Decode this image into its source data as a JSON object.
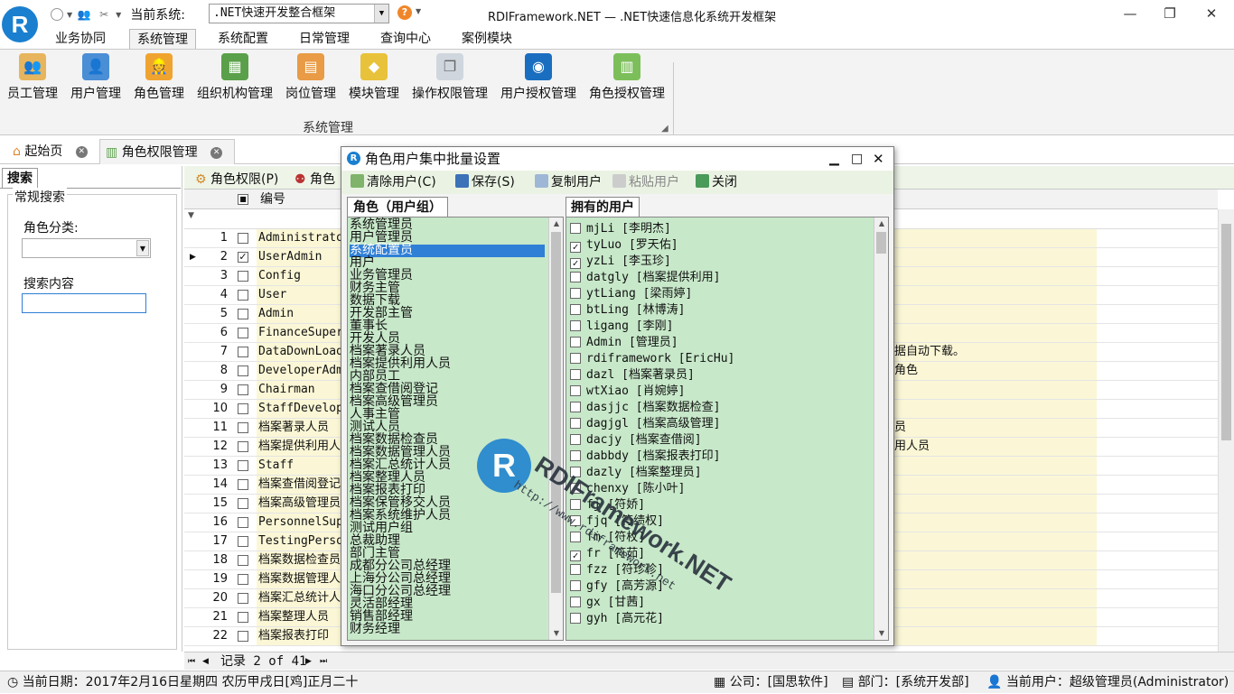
{
  "title_bar": {
    "logo_letter": "R",
    "current_system_label": "当前系统:",
    "current_system_value": ".NET快速开发整合框架",
    "window_title": "RDIFramework.NET — .NET快速信息化系统开发框架",
    "minimize": "—",
    "maximize": "❐",
    "close": "✕"
  },
  "menu_tabs": [
    "业务协同",
    "系统管理",
    "系统配置",
    "日常管理",
    "查询中心",
    "案例模块"
  ],
  "active_menu_tab": "系统管理",
  "ribbon": {
    "buttons": [
      "员工管理",
      "用户管理",
      "角色管理",
      "组织机构管理",
      "岗位管理",
      "模块管理",
      "操作权限管理",
      "用户授权管理",
      "角色授权管理"
    ],
    "group_label": "系统管理"
  },
  "doc_tabs": [
    {
      "label": "起始页"
    },
    {
      "label": "角色权限管理"
    }
  ],
  "left_panel": {
    "tab": "搜索",
    "legend": "常规搜索",
    "category_label": "角色分类:",
    "category_value": "",
    "content_label": "搜索内容",
    "content_value": ""
  },
  "grid": {
    "toolbar": [
      "角色权限(P)",
      "角色"
    ],
    "header_col": "编号",
    "rows": [
      {
        "n": "1",
        "code": "Administrator",
        "checked": false,
        "extra": ""
      },
      {
        "n": "2",
        "code": "UserAdmin",
        "checked": true,
        "extra": ""
      },
      {
        "n": "3",
        "code": "Config",
        "checked": false,
        "extra": ""
      },
      {
        "n": "4",
        "code": "User",
        "checked": false,
        "extra": ""
      },
      {
        "n": "5",
        "code": "Admin",
        "checked": false,
        "extra": ""
      },
      {
        "n": "6",
        "code": "FinanceSuperv",
        "checked": false,
        "extra": ""
      },
      {
        "n": "7",
        "code": "DataDownLoad",
        "checked": false,
        "extra": "据自动下载。"
      },
      {
        "n": "8",
        "code": "DeveloperAdmi",
        "checked": false,
        "extra": "角色"
      },
      {
        "n": "9",
        "code": "Chairman",
        "checked": false,
        "extra": ""
      },
      {
        "n": "10",
        "code": "StaffDevelopm",
        "checked": false,
        "extra": ""
      },
      {
        "n": "11",
        "code": "档案著录人员",
        "checked": false,
        "extra": "员"
      },
      {
        "n": "12",
        "code": "档案提供利用人",
        "checked": false,
        "extra": "用人员"
      },
      {
        "n": "13",
        "code": "Staff",
        "checked": false,
        "extra": ""
      },
      {
        "n": "14",
        "code": "档案查借阅登记",
        "checked": false,
        "extra": ""
      },
      {
        "n": "15",
        "code": "档案高级管理员",
        "checked": false,
        "extra": ""
      },
      {
        "n": "16",
        "code": "PersonnelSupe",
        "checked": false,
        "extra": ""
      },
      {
        "n": "17",
        "code": "TestingPerson",
        "checked": false,
        "extra": ""
      },
      {
        "n": "18",
        "code": "档案数据检查员",
        "checked": false,
        "extra": ""
      },
      {
        "n": "19",
        "code": "档案数据管理人",
        "checked": false,
        "extra": ""
      },
      {
        "n": "20",
        "code": "档案汇总统计人",
        "checked": false,
        "extra": ""
      },
      {
        "n": "21",
        "code": "档案整理人员",
        "checked": false,
        "extra": ""
      },
      {
        "n": "22",
        "code": "档案报表打印",
        "checked": false,
        "extra": ""
      }
    ],
    "pager_text": "记录 2 of 41"
  },
  "dialog": {
    "title": "角色用户集中批量设置",
    "toolbar": [
      "清除用户(C)",
      "保存(S)",
      "复制用户",
      "粘贴用户",
      "关闭"
    ],
    "roles_header": "角色（用户组）",
    "users_header": "拥有的用户",
    "roles": [
      "系统管理员",
      "用户管理员",
      "系统配置员",
      "用户",
      "业务管理员",
      "财务主管",
      "数据下载",
      "开发部主管",
      "董事长",
      "开发人员",
      "档案著录人员",
      "档案提供利用人员",
      "内部员工",
      "档案查借阅登记",
      "档案高级管理员",
      "人事主管",
      "测试人员",
      "档案数据检查员",
      "档案数据管理人员",
      "档案汇总统计人员",
      "档案整理人员",
      "档案报表打印",
      "档案保管移交人员",
      "档案系统维护人员",
      "测试用户组",
      "总裁助理",
      "部门主管",
      "成都分公司总经理",
      "上海分公司总经理",
      "海口分公司总经理",
      "灵活部经理",
      "销售部经理",
      "财务经理"
    ],
    "selected_role": "系统配置员",
    "users": [
      {
        "label": "mjLi [李明杰]",
        "checked": false
      },
      {
        "label": "tyLuo [罗天佑]",
        "checked": true
      },
      {
        "label": "yzLi [李玉珍]",
        "checked": true
      },
      {
        "label": "datgly [档案提供利用]",
        "checked": false
      },
      {
        "label": "ytLiang [梁雨婷]",
        "checked": false
      },
      {
        "label": "btLing [林博涛]",
        "checked": false
      },
      {
        "label": "ligang [李刚]",
        "checked": false
      },
      {
        "label": "Admin [管理员]",
        "checked": false
      },
      {
        "label": "rdiframework [EricHu]",
        "checked": false
      },
      {
        "label": "dazl [档案著录员]",
        "checked": false
      },
      {
        "label": "wtXiao [肖婉婷]",
        "checked": false
      },
      {
        "label": "dasjjc [档案数据检查]",
        "checked": false
      },
      {
        "label": "dagjgl [档案高级管理]",
        "checked": false
      },
      {
        "label": "dacjy [档案查借阅]",
        "checked": false
      },
      {
        "label": "dabbdy [档案报表打印]",
        "checked": false
      },
      {
        "label": "dazly [档案整理员]",
        "checked": false
      },
      {
        "label": "chenxy [陈小叶]",
        "checked": false
      },
      {
        "label": "fj [符娇]",
        "checked": false
      },
      {
        "label": "fjq [符绩权]",
        "checked": false
      },
      {
        "label": "fm [符枚]",
        "checked": false
      },
      {
        "label": "fr [符茹]",
        "checked": true
      },
      {
        "label": "fzz [符珍珍]",
        "checked": false
      },
      {
        "label": "gfy [高芳源]",
        "checked": false
      },
      {
        "label": "gx [甘茜]",
        "checked": false
      },
      {
        "label": "gyh [高元花]",
        "checked": false
      }
    ]
  },
  "watermark": {
    "brand": "RDIFramework.NET",
    "url": "http://www.rdiframework.net"
  },
  "status_bar": {
    "date": "当前日期：2017年2月16日星期四 农历甲戌日[鸡]正月二十",
    "company": "公司：[国思软件]",
    "department": "部门：[系统开发部]",
    "user": "当前用户：超级管理员(Administrator)"
  },
  "colors": {
    "accent": "#1a7fcf",
    "list_bg": "#c7e8c9",
    "selection": "#2f7fd6",
    "row_yellow": "#fbf7d6"
  }
}
